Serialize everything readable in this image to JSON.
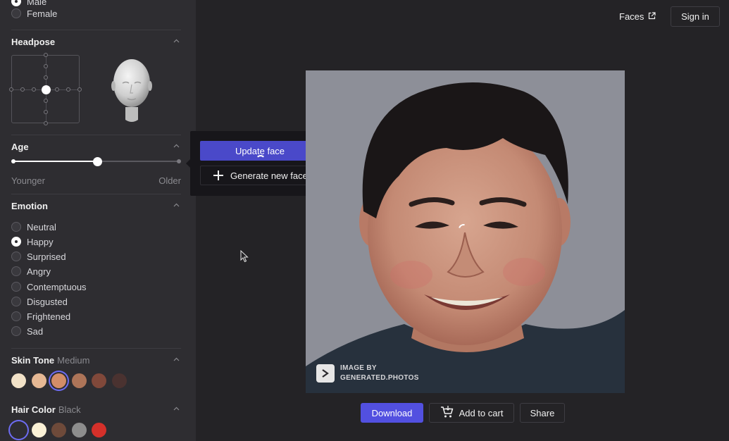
{
  "gender": {
    "options": [
      {
        "label": "Male",
        "checked": true
      },
      {
        "label": "Female",
        "checked": false
      }
    ]
  },
  "headpose": {
    "title": "Headpose"
  },
  "age": {
    "title": "Age",
    "min_label": "Younger",
    "max_label": "Older",
    "value": 0.51
  },
  "emotion": {
    "title": "Emotion",
    "options": [
      {
        "label": "Neutral",
        "checked": false
      },
      {
        "label": "Happy",
        "checked": true
      },
      {
        "label": "Surprised",
        "checked": false
      },
      {
        "label": "Angry",
        "checked": false
      },
      {
        "label": "Contemptuous",
        "checked": false
      },
      {
        "label": "Disgusted",
        "checked": false
      },
      {
        "label": "Frightened",
        "checked": false
      },
      {
        "label": "Sad",
        "checked": false
      }
    ]
  },
  "skin_tone": {
    "title": "Skin Tone",
    "selected": "Medium",
    "swatches": [
      "#f2e2c8",
      "#e6b894",
      "#d28d68",
      "#ad7458",
      "#80483a",
      "#4a3230"
    ],
    "selected_index": 2
  },
  "hair_color": {
    "title": "Hair Color",
    "selected": "Black",
    "swatches": [
      "#2e2d31",
      "#fbf1d6",
      "#6e4a3a",
      "#8d8d8d",
      "#d5302a"
    ],
    "selected_index": 0
  },
  "popup": {
    "update_label": "Update face",
    "generate_label": "Generate new face"
  },
  "header": {
    "faces_label": "Faces",
    "signin_label": "Sign in"
  },
  "watermark": {
    "line1": "IMAGE BY",
    "line2": "GENERATED.PHOTOS"
  },
  "actions": {
    "download_label": "Download",
    "cart_label": "Add to cart",
    "share_label": "Share"
  },
  "colors": {
    "accent": "#5250e0",
    "update_button": "#4a49c9",
    "selected_ring": "#6d6cf2"
  }
}
